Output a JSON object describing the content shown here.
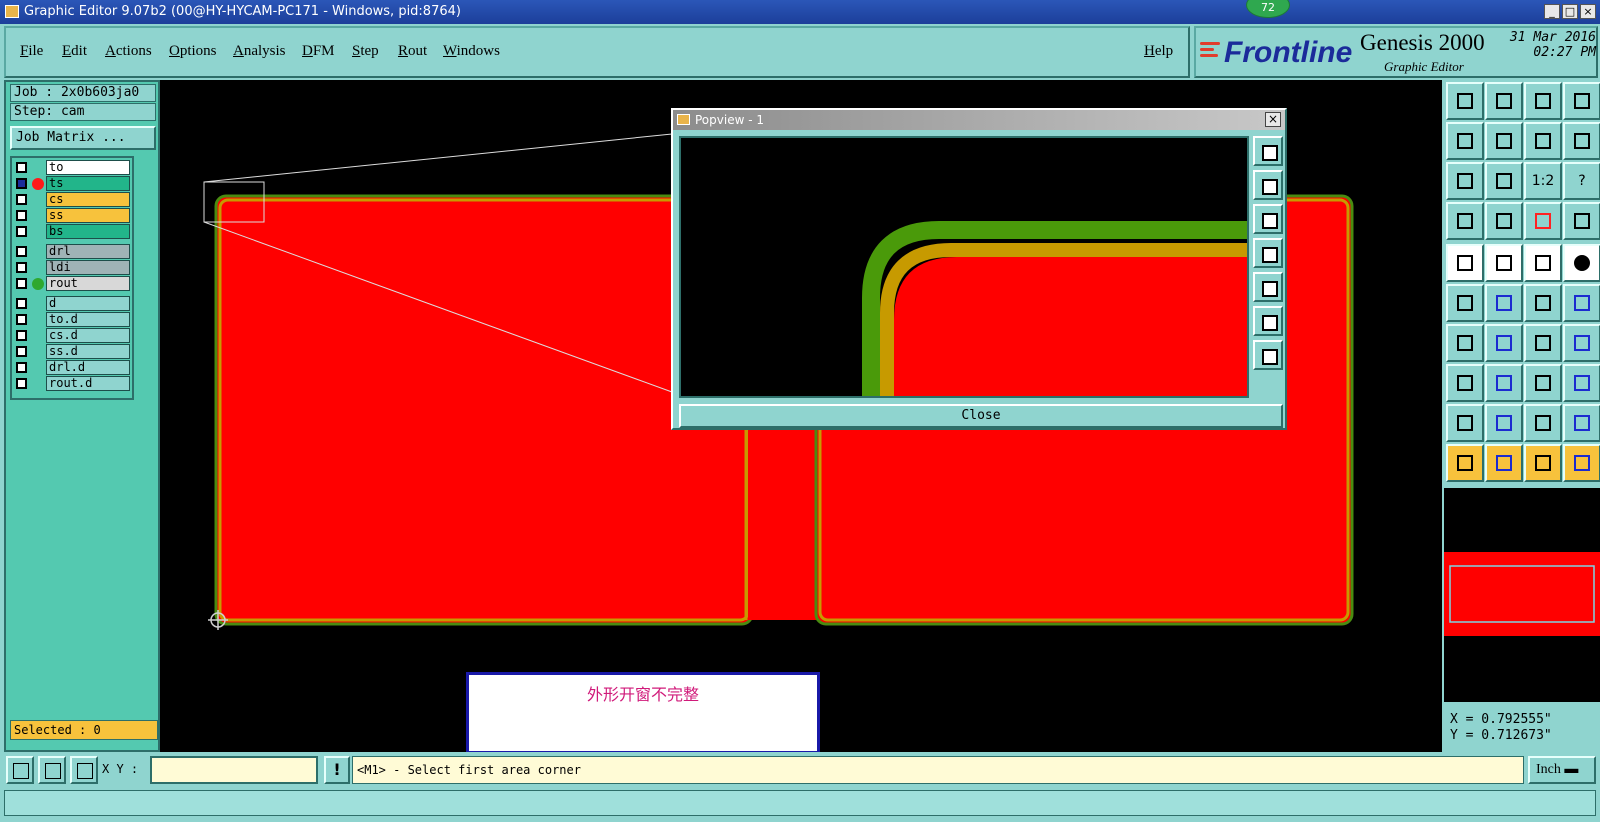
{
  "window": {
    "title": "Graphic Editor 9.07b2 (00@HY-HYCAM-PC171 - Windows, pid:8764)",
    "badge": "72",
    "controls": [
      "_",
      "□",
      "×"
    ]
  },
  "menu": {
    "items": [
      "File",
      "Edit",
      "Actions",
      "Options",
      "Analysis",
      "DFM",
      "Step",
      "Rout",
      "Windows"
    ],
    "help": "Help"
  },
  "brand": {
    "logo": "Frontline",
    "product": "Genesis 2000",
    "subtitle": "Graphic Editor",
    "date": "31 Mar 2016",
    "time": "02:27 PM"
  },
  "left": {
    "job": "Job : 2x0b603ja0",
    "step": "Step: cam",
    "matrix_button": "Job Matrix ...",
    "layers": [
      {
        "name": "to",
        "bg": "#ffffff",
        "dot": ""
      },
      {
        "name": "ts",
        "bg": "#22b58a",
        "dot": "#ff1a1a",
        "checked": true
      },
      {
        "name": "cs",
        "bg": "#f7c23c",
        "dot": ""
      },
      {
        "name": "ss",
        "bg": "#f7c23c",
        "dot": ""
      },
      {
        "name": "bs",
        "bg": "#22b58a",
        "dot": ""
      },
      {
        "name": "drl",
        "bg": "#9fb3b6",
        "dot": ""
      },
      {
        "name": "ldi",
        "bg": "#9fb3b6",
        "dot": ""
      },
      {
        "name": "rout",
        "bg": "#d8d8d8",
        "dot": "#2fa82f"
      },
      {
        "name": "d",
        "bg": "#8fd4cf",
        "dot": ""
      },
      {
        "name": "to.d",
        "bg": "#8fd4cf",
        "dot": ""
      },
      {
        "name": "cs.d",
        "bg": "#8fd4cf",
        "dot": ""
      },
      {
        "name": "ss.d",
        "bg": "#8fd4cf",
        "dot": ""
      },
      {
        "name": "drl.d",
        "bg": "#8fd4cf",
        "dot": ""
      },
      {
        "name": "rout.d",
        "bg": "#8fd4cf",
        "dot": ""
      }
    ],
    "selected": "Selected : 0"
  },
  "canvas": {
    "message": "外形开窗不完整"
  },
  "popview": {
    "title": "Popview - 1",
    "close_label": "Close"
  },
  "coords": {
    "x": "X = 0.792555\"",
    "y": "Y = 0.712673\""
  },
  "bottom": {
    "xy_label": "X Y :",
    "xy_value": "",
    "excl": "!",
    "prompt": "<M1> - Select first area corner",
    "units": "Inch"
  },
  "colors": {
    "panel": "#8fd4cf",
    "copper": "#ff0000",
    "outline": "#4a8c10",
    "mask": "#c79a00"
  },
  "tool_labels": {
    "ratio": "1:2",
    "help": "?"
  }
}
